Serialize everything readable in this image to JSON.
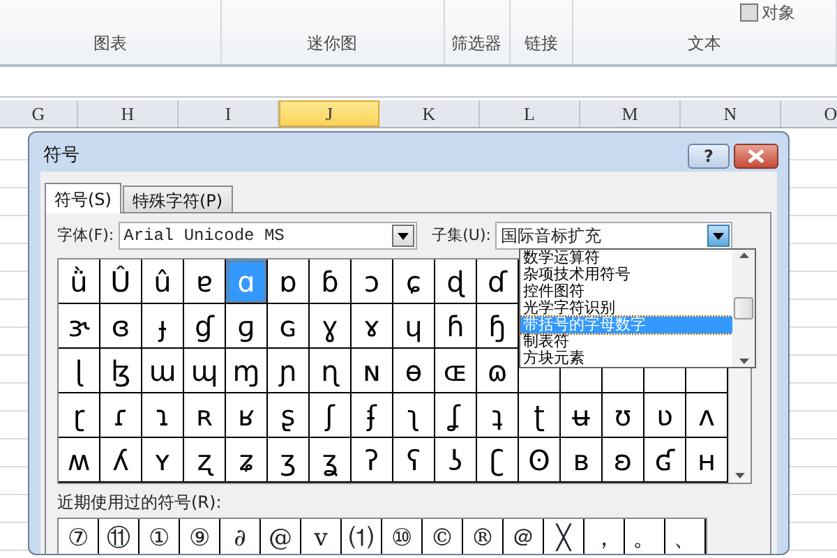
{
  "ribbon": {
    "partial_item": "对象",
    "groups": [
      {
        "label": "图表"
      },
      {
        "label": "迷你图"
      },
      {
        "label": "筛选器"
      },
      {
        "label": "链接"
      },
      {
        "label": "文本"
      }
    ]
  },
  "columns": [
    {
      "label": "G",
      "selected": false
    },
    {
      "label": "H",
      "selected": false
    },
    {
      "label": "I",
      "selected": false
    },
    {
      "label": "J",
      "selected": true
    },
    {
      "label": "K",
      "selected": false
    },
    {
      "label": "L",
      "selected": false
    },
    {
      "label": "M",
      "selected": false
    },
    {
      "label": "N",
      "selected": false
    },
    {
      "label": "O",
      "selected": false
    }
  ],
  "dialog": {
    "title": "符号",
    "help_button": "?",
    "tabs": [
      {
        "label": "符号(S)",
        "selected": true
      },
      {
        "label": "特殊字符(P)",
        "selected": false
      }
    ],
    "font_label": "字体(F):",
    "font_value": "Arial Unicode MS",
    "subset_label": "子集(U):",
    "subset_value": "国际音标扩充",
    "subset_list": [
      {
        "label": "数学运算符",
        "selected": false
      },
      {
        "label": "杂项技术用符号",
        "selected": false
      },
      {
        "label": "控件图符",
        "selected": false
      },
      {
        "label": "光学字符识别",
        "selected": false
      },
      {
        "label": "带括号的字母数字",
        "selected": true
      },
      {
        "label": "制表符",
        "selected": false
      },
      {
        "label": "方块元素",
        "selected": false
      }
    ],
    "symbol_rows": [
      {
        "cells": [
          {
            "c": "ǜ",
            "selected": false
          },
          {
            "c": "Û",
            "selected": false
          },
          {
            "c": "û",
            "selected": false
          },
          {
            "c": "ɐ",
            "selected": false
          },
          {
            "c": "ɑ",
            "selected": true
          },
          {
            "c": "ɒ",
            "selected": false
          },
          {
            "c": "ɓ",
            "selected": false
          },
          {
            "c": "ɔ",
            "selected": false
          },
          {
            "c": "ɕ",
            "selected": false
          },
          {
            "c": "ɖ",
            "selected": false
          },
          {
            "c": "ɗ",
            "selected": false
          }
        ]
      },
      {
        "cells": [
          {
            "c": "ɝ",
            "selected": false
          },
          {
            "c": "ɞ",
            "selected": false
          },
          {
            "c": "ɟ",
            "selected": false
          },
          {
            "c": "ɠ",
            "selected": false
          },
          {
            "c": "ɡ",
            "selected": false
          },
          {
            "c": "ɢ",
            "selected": false
          },
          {
            "c": "ɣ",
            "selected": false
          },
          {
            "c": "ɤ",
            "selected": false
          },
          {
            "c": "ɥ",
            "selected": false
          },
          {
            "c": "ɦ",
            "selected": false
          },
          {
            "c": "ɧ",
            "selected": false
          }
        ]
      },
      {
        "cells": [
          {
            "c": "ɭ",
            "selected": false
          },
          {
            "c": "ɮ",
            "selected": false
          },
          {
            "c": "ɯ",
            "selected": false
          },
          {
            "c": "ɰ",
            "selected": false
          },
          {
            "c": "ɱ",
            "selected": false
          },
          {
            "c": "ɲ",
            "selected": false
          },
          {
            "c": "ɳ",
            "selected": false
          },
          {
            "c": "ɴ",
            "selected": false
          },
          {
            "c": "ɵ",
            "selected": false
          },
          {
            "c": "ɶ",
            "selected": false
          },
          {
            "c": "ɷ",
            "selected": false
          }
        ]
      },
      {
        "cells": [
          {
            "c": "ɽ",
            "selected": false
          },
          {
            "c": "ɾ",
            "selected": false
          },
          {
            "c": "ɿ",
            "selected": false
          },
          {
            "c": "ʀ",
            "selected": false
          },
          {
            "c": "ʁ",
            "selected": false
          },
          {
            "c": "ʂ",
            "selected": false
          },
          {
            "c": "ʃ",
            "selected": false
          },
          {
            "c": "ʄ",
            "selected": false
          },
          {
            "c": "ʅ",
            "selected": false
          },
          {
            "c": "ʆ",
            "selected": false
          },
          {
            "c": "ʇ",
            "selected": false
          },
          {
            "c": "ʈ",
            "selected": false
          },
          {
            "c": "ʉ",
            "selected": false
          },
          {
            "c": "ʊ",
            "selected": false
          },
          {
            "c": "ʋ",
            "selected": false
          },
          {
            "c": "ʌ",
            "selected": false
          }
        ]
      },
      {
        "cells": [
          {
            "c": "ʍ",
            "selected": false
          },
          {
            "c": "ʎ",
            "selected": false
          },
          {
            "c": "ʏ",
            "selected": false
          },
          {
            "c": "ʐ",
            "selected": false
          },
          {
            "c": "ʑ",
            "selected": false
          },
          {
            "c": "ʒ",
            "selected": false
          },
          {
            "c": "ʓ",
            "selected": false
          },
          {
            "c": "ʔ",
            "selected": false
          },
          {
            "c": "ʕ",
            "selected": false
          },
          {
            "c": "ʖ",
            "selected": false
          },
          {
            "c": "ʗ",
            "selected": false
          },
          {
            "c": "ʘ",
            "selected": false
          },
          {
            "c": "ʙ",
            "selected": false
          },
          {
            "c": "ʚ",
            "selected": false
          },
          {
            "c": "ʛ",
            "selected": false
          },
          {
            "c": "ʜ",
            "selected": false
          }
        ]
      }
    ],
    "recent_label": "近期使用过的符号(R):",
    "recent_symbols": [
      "⑦",
      "⑪",
      "①",
      "⑨",
      "∂",
      "@",
      "v",
      "⑴",
      "⑩",
      "©",
      "®",
      "＠",
      "╳",
      "，",
      "。",
      "、"
    ]
  }
}
